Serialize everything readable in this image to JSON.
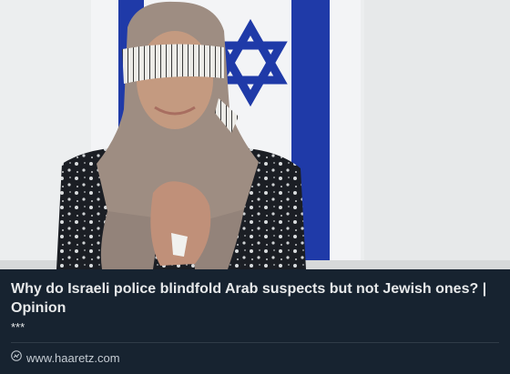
{
  "card": {
    "headline": "Why do Israeli police blindfold Arab suspects but not Jewish ones? | Opinion",
    "description": "***",
    "domain": "www.haaretz.com",
    "domain_icon": "link-icon"
  },
  "colors": {
    "card_background": "#172330",
    "text": "#e7e9ea",
    "flag_blue": "#1f3aa8",
    "flag_white": "#f4f5f7"
  }
}
